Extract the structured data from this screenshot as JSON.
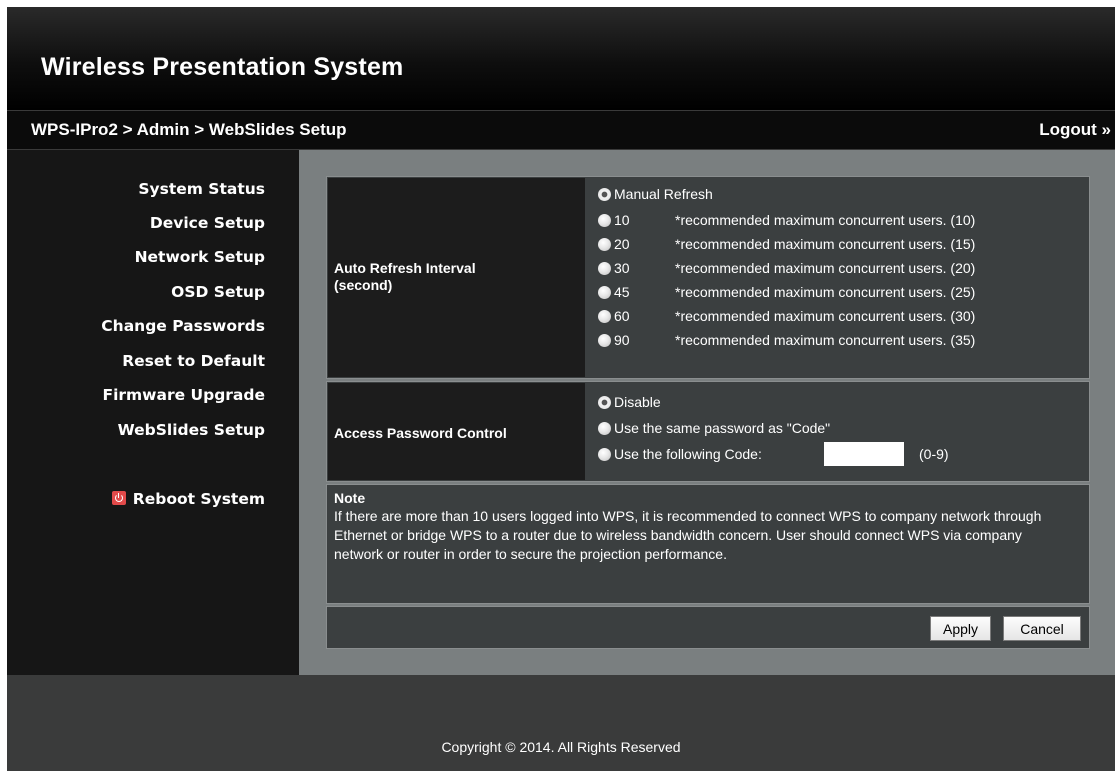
{
  "header": {
    "title": "Wireless Presentation System"
  },
  "breadcrumb": {
    "path": "WPS-IPro2 > Admin > WebSlides Setup",
    "logout": "Logout »"
  },
  "sidebar": {
    "items": [
      {
        "label": "System Status"
      },
      {
        "label": "Device Setup"
      },
      {
        "label": "Network Setup"
      },
      {
        "label": "OSD Setup"
      },
      {
        "label": "Change Passwords"
      },
      {
        "label": "Reset to Default"
      },
      {
        "label": "Firmware Upgrade"
      },
      {
        "label": "WebSlides Setup"
      }
    ],
    "reboot": {
      "label": "Reboot System",
      "icon": "power-icon"
    }
  },
  "refresh": {
    "label": "Auto Refresh Interval (second)",
    "manual": {
      "label": "Manual Refresh",
      "checked": true
    },
    "options": [
      {
        "value": "10",
        "note": "*recommended maximum concurrent users. (10)"
      },
      {
        "value": "20",
        "note": "*recommended maximum concurrent users. (15)"
      },
      {
        "value": "30",
        "note": "*recommended maximum concurrent users. (20)"
      },
      {
        "value": "45",
        "note": "*recommended maximum concurrent users. (25)"
      },
      {
        "value": "60",
        "note": "*recommended maximum concurrent users. (30)"
      },
      {
        "value": "90",
        "note": "*recommended maximum concurrent users. (35)"
      }
    ]
  },
  "access": {
    "label": "Access Password Control",
    "options": [
      {
        "label": "Disable",
        "checked": true
      },
      {
        "label": "Use the same password as \"Code\""
      },
      {
        "label": "Use the following Code:"
      }
    ],
    "code_value": "",
    "code_range": "(0-9)"
  },
  "note": {
    "title": "Note",
    "body": "If there are more than 10 users logged into WPS, it is recommended to connect WPS to company network through Ethernet or bridge WPS to a router due to wireless bandwidth concern. User should connect WPS via company network or router in order to secure the projection performance."
  },
  "buttons": {
    "apply": "Apply",
    "cancel": "Cancel"
  },
  "footer": {
    "copyright": "Copyright © 2014. All Rights Reserved"
  },
  "colors": {
    "header_bg": "#000000",
    "sidebar_bg": "#161616",
    "main_bg": "#7a7f80",
    "panel_bg": "#3b3f40",
    "label_bg": "#1c1c1c",
    "footer_bg": "#3a3b3b",
    "reboot_icon": "#e24a4a"
  }
}
